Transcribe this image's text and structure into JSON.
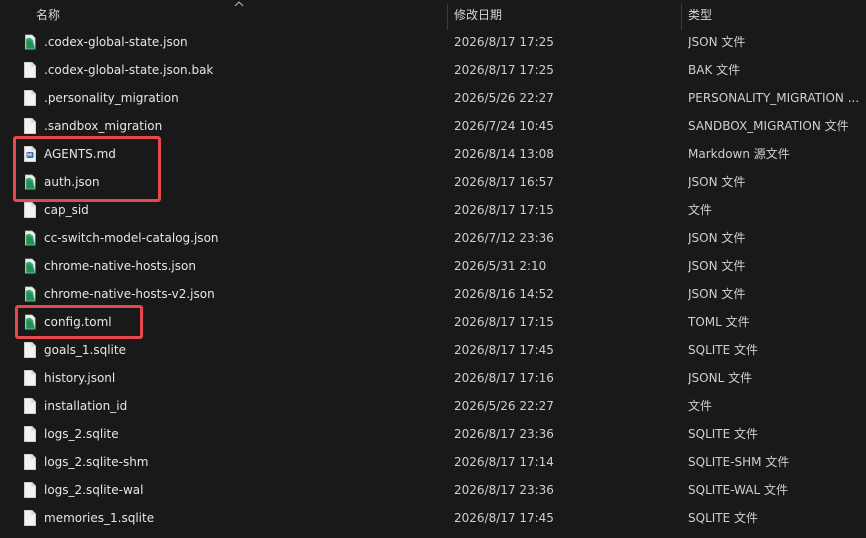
{
  "columns": {
    "name": "名称",
    "date": "修改日期",
    "type": "类型"
  },
  "files": [
    {
      "name": ".codex-global-state.json",
      "date": "2026/8/17 17:25",
      "type": "JSON 文件",
      "icon": "json-file-icon"
    },
    {
      "name": ".codex-global-state.json.bak",
      "date": "2026/8/17 17:25",
      "type": "BAK 文件",
      "icon": "blank-file-icon"
    },
    {
      "name": ".personality_migration",
      "date": "2026/5/26 22:27",
      "type": "PERSONALITY_MIGRATION ...",
      "icon": "blank-file-icon"
    },
    {
      "name": ".sandbox_migration",
      "date": "2026/7/24 10:45",
      "type": "SANDBOX_MIGRATION 文件",
      "icon": "blank-file-icon"
    },
    {
      "name": "AGENTS.md",
      "date": "2026/8/14 13:08",
      "type": "Markdown 源文件",
      "icon": "markdown-file-icon"
    },
    {
      "name": "auth.json",
      "date": "2026/8/17 16:57",
      "type": "JSON 文件",
      "icon": "json-file-icon"
    },
    {
      "name": "cap_sid",
      "date": "2026/8/17 17:15",
      "type": "文件",
      "icon": "blank-file-icon"
    },
    {
      "name": "cc-switch-model-catalog.json",
      "date": "2026/7/12 23:36",
      "type": "JSON 文件",
      "icon": "json-file-icon"
    },
    {
      "name": "chrome-native-hosts.json",
      "date": "2026/5/31 2:10",
      "type": "JSON 文件",
      "icon": "json-file-icon"
    },
    {
      "name": "chrome-native-hosts-v2.json",
      "date": "2026/8/16 14:52",
      "type": "JSON 文件",
      "icon": "json-file-icon"
    },
    {
      "name": "config.toml",
      "date": "2026/8/17 17:15",
      "type": "TOML 文件",
      "icon": "toml-file-icon"
    },
    {
      "name": "goals_1.sqlite",
      "date": "2026/8/17 17:45",
      "type": "SQLITE 文件",
      "icon": "blank-file-icon"
    },
    {
      "name": "history.jsonl",
      "date": "2026/8/17 17:16",
      "type": "JSONL 文件",
      "icon": "blank-file-icon"
    },
    {
      "name": "installation_id",
      "date": "2026/5/26 22:27",
      "type": "文件",
      "icon": "blank-file-icon"
    },
    {
      "name": "logs_2.sqlite",
      "date": "2026/8/17 23:36",
      "type": "SQLITE 文件",
      "icon": "blank-file-icon"
    },
    {
      "name": "logs_2.sqlite-shm",
      "date": "2026/8/17 17:14",
      "type": "SQLITE-SHM 文件",
      "icon": "blank-file-icon"
    },
    {
      "name": "logs_2.sqlite-wal",
      "date": "2026/8/17 23:36",
      "type": "SQLITE-WAL 文件",
      "icon": "blank-file-icon"
    },
    {
      "name": "memories_1.sqlite",
      "date": "2026/8/17 17:45",
      "type": "SQLITE 文件",
      "icon": "blank-file-icon"
    }
  ],
  "colors": {
    "background": "#191919",
    "highlight": "#e5484d",
    "json_icon": "#3aa76d"
  }
}
